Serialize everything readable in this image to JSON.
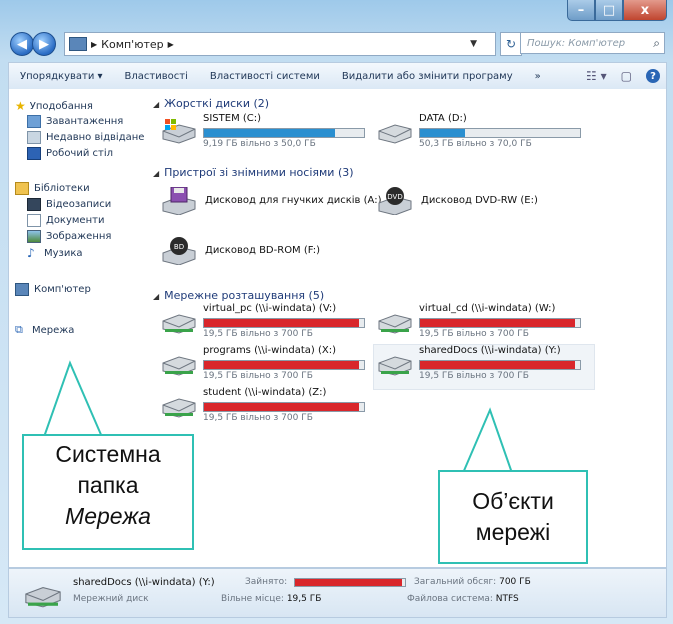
{
  "address": {
    "path_label": "Комп'ютер",
    "search_placeholder": "Пошук: Комп'ютер"
  },
  "toolbar": {
    "organize": "Упорядкувати ▾",
    "properties": "Властивості",
    "system_properties": "Властивості системи",
    "uninstall": "Видалити або змінити програму",
    "more": "»"
  },
  "sidebar": {
    "favorites": "Уподобання",
    "downloads": "Завантаження",
    "recent": "Недавно відвідане",
    "desktop": "Робочий стіл",
    "libraries": "Бібліотеки",
    "videos": "Відеозаписи",
    "documents": "Документи",
    "pictures": "Зображення",
    "music": "Музика",
    "computer": "Комп'ютер",
    "network": "Мережа"
  },
  "groups": {
    "hdd": "Жорсткі диски (2)",
    "removable": "Пристрої зі знімними носіями (3)",
    "network": "Мережне розташування (5)"
  },
  "hdd": [
    {
      "name": "SISTEM (C:)",
      "free": "9,19 ГБ вільно з 50,0 ГБ",
      "used_fraction": 0.82,
      "color": "#2a8fd0"
    },
    {
      "name": "DATA (D:)",
      "free": "50,3 ГБ вільно з 70,0 ГБ",
      "used_fraction": 0.28,
      "color": "#2a8fd0"
    }
  ],
  "removable": [
    {
      "name": "Дисковод для гнучких дисків (A:)"
    },
    {
      "name": "Дисковод DVD-RW (E:)"
    },
    {
      "name": "Дисковод BD-ROM (F:)"
    }
  ],
  "network": [
    {
      "name": "virtual_pc (\\\\i-windata) (V:)",
      "free": "19,5 ГБ вільно з 700 ГБ",
      "used_fraction": 0.97,
      "color": "#d9262b"
    },
    {
      "name": "virtual_cd (\\\\i-windata) (W:)",
      "free": "19,5 ГБ вільно з 700 ГБ",
      "used_fraction": 0.97,
      "color": "#d9262b"
    },
    {
      "name": "programs (\\\\i-windata) (X:)",
      "free": "19,5 ГБ вільно з 700 ГБ",
      "used_fraction": 0.97,
      "color": "#d9262b"
    },
    {
      "name": "sharedDocs (\\\\i-windata) (Y:)",
      "free": "19,5 ГБ вільно з 700 ГБ",
      "used_fraction": 0.97,
      "color": "#d9262b"
    },
    {
      "name": "student (\\\\i-windata) (Z:)",
      "free": "19,5 ГБ вільно з 700 ГБ",
      "used_fraction": 0.97,
      "color": "#d9262b"
    }
  ],
  "details": {
    "name": "sharedDocs (\\\\i-windata) (Y:)",
    "type": "Мережний диск",
    "used_label": "Зайнято:",
    "used_fraction": 0.97,
    "free_label": "Вільне місце:",
    "free_value": "19,5 ГБ",
    "total_label": "Загальний обсяг:",
    "total_value": "700 ГБ",
    "fs_label": "Файлова система:",
    "fs_value": "NTFS"
  },
  "callouts": {
    "left_line1": "Системна",
    "left_line2": "папка",
    "left_line3": "Мережа",
    "right_line1": "Об’єкти",
    "right_line2": "мережі"
  }
}
